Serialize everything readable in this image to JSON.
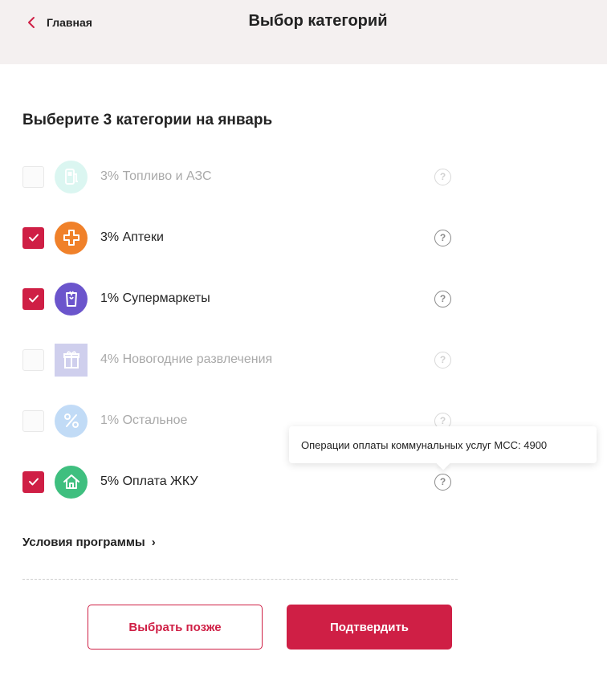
{
  "header": {
    "back_label": "Главная",
    "title": "Выбор категорий"
  },
  "section_title": "Выберите 3 категории на январь",
  "categories": [
    {
      "label": "3% Топливо и АЗС",
      "checked": false,
      "disabled": true,
      "icon": "fuel-pump-icon",
      "color": "#7fdccc"
    },
    {
      "label": "3% Аптеки",
      "checked": true,
      "disabled": false,
      "icon": "pharmacy-cross-icon",
      "color": "#f0812a"
    },
    {
      "label": "1% Супермаркеты",
      "checked": true,
      "disabled": false,
      "icon": "shopping-bag-icon",
      "color": "#6b55cc"
    },
    {
      "label": "4% Новогодние развлечения",
      "checked": false,
      "disabled": true,
      "icon": "gift-icon",
      "color": "#a8a8e0"
    },
    {
      "label": "1% Остальное",
      "checked": false,
      "disabled": true,
      "icon": "percent-icon",
      "color": "#8fbef0"
    },
    {
      "label": "5% Оплата ЖКУ",
      "checked": true,
      "disabled": false,
      "icon": "house-icon",
      "color": "#3fbf7f"
    }
  ],
  "help_symbol": "?",
  "tooltip_text": "Операции оплаты коммунальных услуг MCC: 4900",
  "terms_link": "Условия программы",
  "terms_chevron": "›",
  "buttons": {
    "later": "Выбрать позже",
    "confirm": "Подтвердить"
  },
  "colors": {
    "accent": "#cf1f45",
    "header_bg": "#f4f0f0"
  }
}
